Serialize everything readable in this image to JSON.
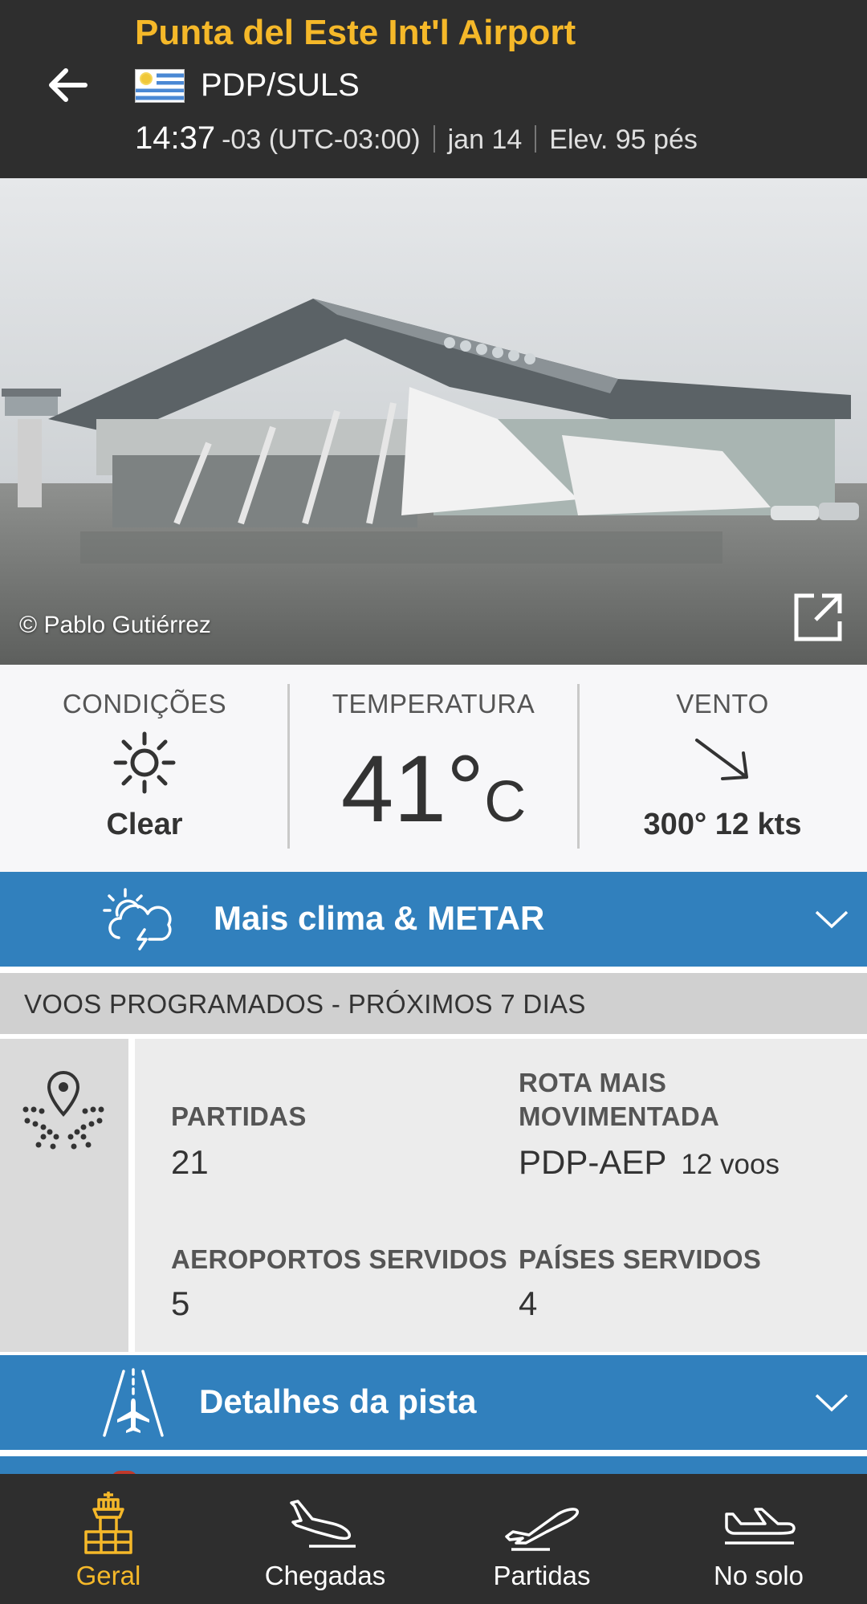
{
  "header": {
    "airport_name": "Punta del Este Int'l Airport",
    "codes": "PDP/SULS",
    "local_time": "14:37",
    "timezone": "-03 (UTC-03:00)",
    "date": "jan 14",
    "elevation": "Elev. 95 pés"
  },
  "photo": {
    "credit": "© Pablo Gutiérrez"
  },
  "weather": {
    "conditions_label": "CONDIÇÕES",
    "conditions_value": "Clear",
    "temperature_label": "TEMPERATURA",
    "temperature_value": "41°",
    "temperature_unit": "C",
    "wind_label": "VENTO",
    "wind_value": "300° 12 kts"
  },
  "metar_bar": {
    "label": "Mais clima & METAR"
  },
  "scheduled": {
    "title": "VOOS PROGRAMADOS - PRÓXIMOS 7 DIAS",
    "departures_label": "PARTIDAS",
    "departures_value": "21",
    "busiest_route_label_line1": "ROTA MAIS",
    "busiest_route_label_line2": "MOVIMENTADA",
    "busiest_route_value": "PDP-AEP",
    "busiest_route_flights": "12 voos",
    "airports_label": "AEROPORTOS SERVIDOS",
    "airports_value": "5",
    "countries_label": "PAÍSES SERVIDOS",
    "countries_value": "4"
  },
  "runway_bar": {
    "label": "Detalhes da pista"
  },
  "tabs": [
    {
      "label": "Geral",
      "icon": "control-tower-icon",
      "active": true
    },
    {
      "label": "Chegadas",
      "icon": "arrival-plane-icon",
      "active": false
    },
    {
      "label": "Partidas",
      "icon": "departure-plane-icon",
      "active": false
    },
    {
      "label": "No solo",
      "icon": "plane-on-ground-icon",
      "active": false
    }
  ],
  "colors": {
    "header_bg": "#2e2e2e",
    "accent_yellow": "#f5b829",
    "bar_blue": "#3180bd",
    "section_gray": "#d0d0d0"
  }
}
